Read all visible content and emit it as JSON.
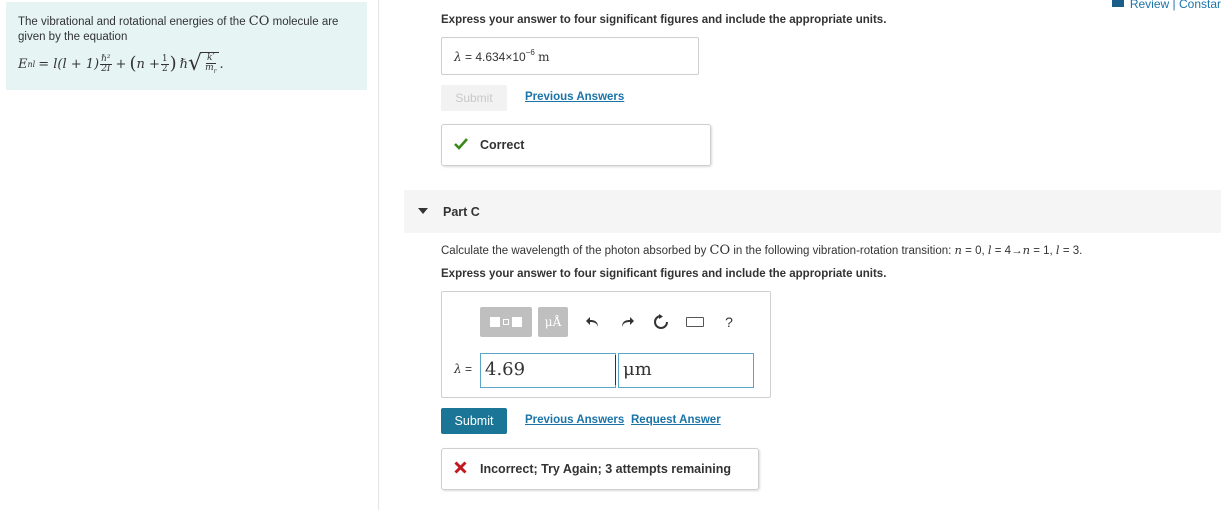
{
  "left_panel": {
    "intro_text": "The vibrational and rotational energies of the",
    "molecule": "CO",
    "intro_text_end": "molecule are given by the equation",
    "equation": {
      "lhs": "E",
      "lhs_sub": "nl",
      "rot_term": "= l(l + 1)",
      "rot_num": "ℏ²",
      "rot_den": "2I",
      "plus": "+",
      "n_term": "n +",
      "half_num": "1",
      "half_den": "2",
      "hbar": "ℏ",
      "sqrt_num": "k′",
      "sqrt_den": "m",
      "sqrt_den_sub": "r",
      "end": "."
    }
  },
  "header": {
    "review_link": "Review | Constar"
  },
  "part_b": {
    "instruction": "Express your answer to four significant figures and include the appropriate units.",
    "answer": {
      "symbol": "λ",
      "equals": "=",
      "mantissa": "4.634×10",
      "exponent": "−6",
      "unit": "m"
    },
    "submit_label": "Submit",
    "previous_answers_label": "Previous Answers",
    "feedback": {
      "icon": "check-icon",
      "text": "Correct",
      "color": "#3a8a1a"
    }
  },
  "part_c": {
    "title": "Part C",
    "question_pre": "Calculate the wavelength of the photon absorbed by",
    "question_molecule": "CO",
    "question_mid": "in the following vibration-rotation transition:",
    "transition": {
      "n1_sym": "n",
      "n1": "= 0,",
      "l1_sym": "l",
      "l1": "= 4",
      "arrow": "→",
      "n2_sym": "n",
      "n2": "= 1,",
      "l2_sym": "l",
      "l2": "= 3."
    },
    "instruction": "Express your answer to four significant figures and include the appropriate units.",
    "toolbar": {
      "units_label": "μÅ",
      "undo": "↶",
      "redo": "↷",
      "reset": "↻",
      "help": "?"
    },
    "input": {
      "symbol": "λ",
      "equals": "=",
      "value": "4.69",
      "unit": "μm"
    },
    "submit_label": "Submit",
    "previous_answers_label": "Previous Answers",
    "request_answer_label": "Request Answer",
    "feedback": {
      "icon": "x-icon",
      "text": "Incorrect; Try Again; 3 attempts remaining",
      "color": "#c2181f"
    }
  }
}
